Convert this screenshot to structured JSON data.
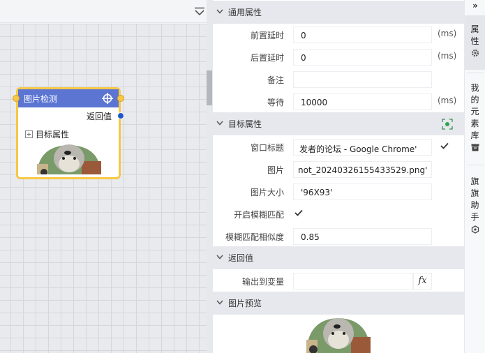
{
  "node": {
    "title": "图片检测",
    "return_label": "返回值",
    "target_attr_label": "目标属性"
  },
  "sections": {
    "general": "通用属性",
    "target": "目标属性",
    "return": "返回值",
    "preview": "图片预览"
  },
  "general": {
    "pre_delay_label": "前置延时",
    "pre_delay_value": "0",
    "post_delay_label": "后置延时",
    "post_delay_value": "0",
    "note_label": "备注",
    "note_value": "",
    "wait_label": "等待",
    "wait_value": "10000",
    "unit_ms": "(ms)"
  },
  "target": {
    "window_title_label": "窗口标题",
    "window_title_value": "发者的论坛 - Google Chrome'",
    "image_label": "图片",
    "image_value": "not_20240326155433529.png'",
    "image_size_label": "图片大小",
    "image_size_value": "'96X93'",
    "fuzzy_label": "开启模糊匹配",
    "similarity_label": "模糊匹配相似度",
    "similarity_value": "0.85"
  },
  "return": {
    "output_label": "输出到变量",
    "output_value": "",
    "fx_label": "fx"
  },
  "side_tabs": {
    "toggle": "»",
    "props": [
      "属",
      "性"
    ],
    "elements": [
      "我",
      "的",
      "元",
      "素",
      "库"
    ],
    "assist": [
      "旗",
      "旗",
      "助",
      "手"
    ]
  },
  "icons": {
    "collapse": "chevron-down-double-icon",
    "target": "crosshair-icon",
    "eye": "eye-icon",
    "gear": "gear-icon",
    "archive": "archive-icon",
    "robot": "robot-icon",
    "check": "check-icon",
    "expand": "plus-square-icon"
  },
  "colors": {
    "node_header": "#5c75d3",
    "node_border": "#f7c845",
    "output_port": "#1f58c7",
    "eye_accent": "#2ea44f"
  }
}
